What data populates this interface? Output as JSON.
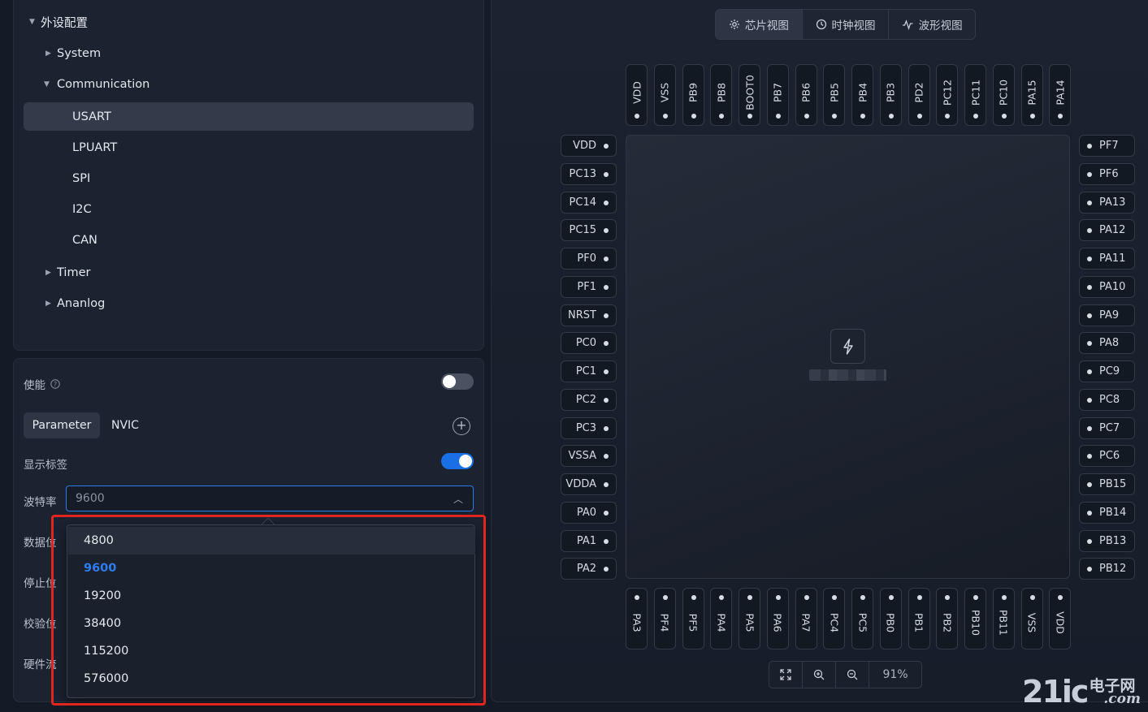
{
  "tree": {
    "root": "外设配置",
    "groups": [
      {
        "label": "System",
        "expanded": false
      },
      {
        "label": "Communication",
        "expanded": true
      },
      {
        "label": "Timer",
        "expanded": false
      },
      {
        "label": "Ananlog",
        "expanded": false
      }
    ],
    "communication_items": [
      "USART",
      "LPUART",
      "SPI",
      "I2C",
      "CAN"
    ],
    "selected": "USART"
  },
  "config": {
    "enable_label": "使能",
    "enable_on": false,
    "tabs": [
      {
        "label": "Parameter",
        "active": true
      },
      {
        "label": "NVIC",
        "active": false
      }
    ],
    "add_icon": "plus-circle-icon",
    "show_labels_label": "显示标签",
    "show_labels_on": true,
    "baud_label": "波特率",
    "baud_value": "9600",
    "data_bits_label": "数据位",
    "stop_bits_label": "停止位",
    "parity_label": "校验位",
    "flow_label": "硬件流"
  },
  "baud_options": [
    "4800",
    "9600",
    "19200",
    "38400",
    "115200",
    "576000"
  ],
  "baud_selected": "9600",
  "views": [
    {
      "label": "芯片视图",
      "icon": "gear-icon",
      "active": true
    },
    {
      "label": "时钟视图",
      "icon": "clock-icon",
      "active": false
    },
    {
      "label": "波形视图",
      "icon": "waveform-icon",
      "active": false
    }
  ],
  "pins": {
    "top": [
      "VDD",
      "VSS",
      "PB9",
      "PB8",
      "BOOT0",
      "PB7",
      "PB6",
      "PB5",
      "PB4",
      "PB3",
      "PD2",
      "PC12",
      "PC11",
      "PC10",
      "PA15",
      "PA14"
    ],
    "left": [
      "VDD",
      "PC13",
      "PC14",
      "PC15",
      "PF0",
      "PF1",
      "NRST",
      "PC0",
      "PC1",
      "PC2",
      "PC3",
      "VSSA",
      "VDDA",
      "PA0",
      "PA1",
      "PA2"
    ],
    "right": [
      "PF7",
      "PF6",
      "PA13",
      "PA12",
      "PA11",
      "PA10",
      "PA9",
      "PA8",
      "PC9",
      "PC8",
      "PC7",
      "PC6",
      "PB15",
      "PB14",
      "PB13",
      "PB12"
    ],
    "bottom": [
      "PA3",
      "PF4",
      "PF5",
      "PA4",
      "PA5",
      "PA6",
      "PA7",
      "PC4",
      "PC5",
      "PB0",
      "PB1",
      "PB2",
      "PB10",
      "PB11",
      "VSS",
      "VDD"
    ]
  },
  "zoom": {
    "level": "91%",
    "icons": [
      "fit-screen-icon",
      "zoom-in-icon",
      "zoom-out-icon"
    ]
  },
  "watermark": {
    "number": "21ic",
    "chinese": "电子网",
    "domain": ".com"
  },
  "colors": {
    "accent": "#2f7cf0",
    "highlight_box": "#e0261f",
    "toggle_on": "#1b6fe6"
  }
}
